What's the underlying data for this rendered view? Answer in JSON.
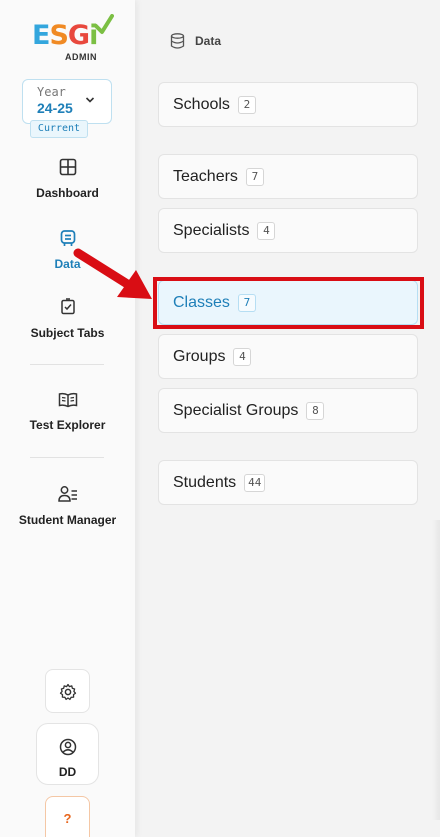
{
  "logo": {
    "letters": [
      "E",
      "S",
      "G",
      "i"
    ],
    "subtitle": "ADMIN"
  },
  "year_selector": {
    "label": "Year",
    "value": "24-25",
    "badge": "Current",
    "icon": "chevron-down-icon"
  },
  "nav": {
    "items": [
      {
        "label": "Dashboard",
        "icon": "grid-icon",
        "active": false
      },
      {
        "label": "Data",
        "icon": "robot-icon",
        "active": true
      },
      {
        "label": "Subject Tabs",
        "icon": "checklist-icon",
        "active": false
      },
      {
        "label": "Test Explorer",
        "icon": "book-icon",
        "active": false
      },
      {
        "label": "Student Manager",
        "icon": "user-list-icon",
        "active": false
      }
    ]
  },
  "footer": {
    "settings_icon": "gear-icon",
    "profile_initials": "DD",
    "profile_icon": "user-circle-icon",
    "help_label": "?"
  },
  "breadcrumb": {
    "icon": "database-icon",
    "text": "Data"
  },
  "data_rows": [
    {
      "label": "Schools",
      "count": "2"
    },
    {
      "label": "Teachers",
      "count": "7"
    },
    {
      "label": "Specialists",
      "count": "4"
    },
    {
      "label": "Classes",
      "count": "7",
      "selected": true
    },
    {
      "label": "Groups",
      "count": "4"
    },
    {
      "label": "Specialist Groups",
      "count": "8"
    },
    {
      "label": "Students",
      "count": "44"
    }
  ],
  "colors": {
    "accent": "#1e7fb8",
    "annotation_red": "#d90d14",
    "selected_bg": "#eaf6fd"
  }
}
